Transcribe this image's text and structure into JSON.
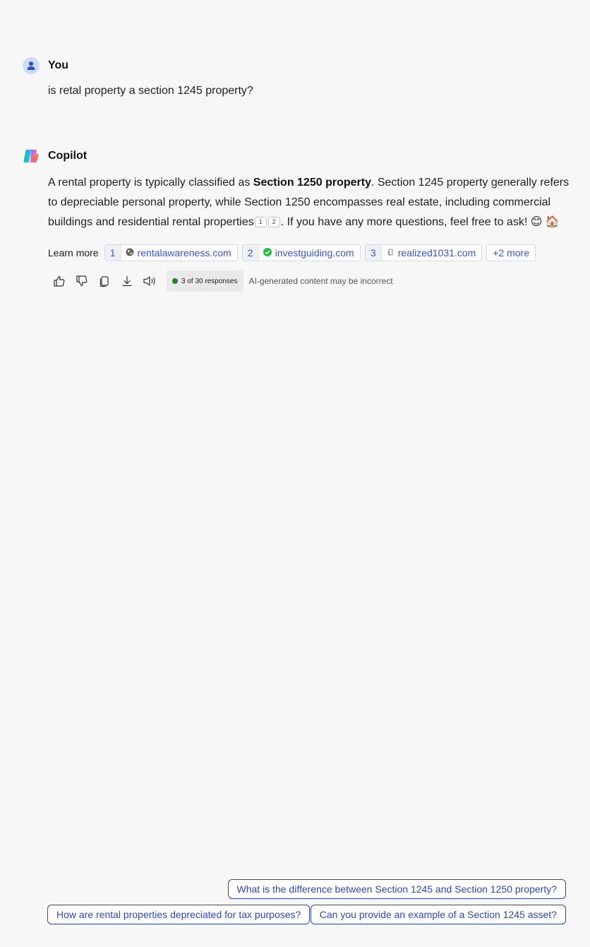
{
  "user": {
    "name": "You",
    "message": "is retal property a section 1245 property?"
  },
  "copilot": {
    "name": "Copilot",
    "answer": {
      "part1": "A rental property is typically classified as ",
      "bold": "Section 1250 property",
      "part2": ". Section 1245 property generally refers to depreciable personal property, while Section 1250 encompasses real estate, including commercial buildings and residential rental properties",
      "cite1": "1",
      "cite2": "2",
      "part3": ". If you have any more questions, feel free to ask! 😊 🏠"
    },
    "learn_more": {
      "label": "Learn more",
      "sources": [
        {
          "num": "1",
          "site": "rentalawareness.com",
          "icon": "globe-icon"
        },
        {
          "num": "2",
          "site": "investguiding.com",
          "icon": "check-circle-icon"
        },
        {
          "num": "3",
          "site": "realized1031.com",
          "icon": "document-icon"
        }
      ],
      "more": "+2 more"
    },
    "actions": {
      "icons": [
        "thumbs-up-icon",
        "thumbs-down-icon",
        "copy-icon",
        "download-icon",
        "speaker-icon"
      ],
      "responses": "3 of 30 responses",
      "disclaimer": "AI-generated content may be incorrect"
    }
  },
  "suggestions": [
    "What is the difference between Section 1245 and Section 1250 property?",
    "How are rental properties depreciated for tax purposes?",
    "Can you provide an example of a Section 1245 asset?"
  ],
  "colors": {
    "background": "#f7f7f7",
    "link": "#3a55c7",
    "suggestion_border": "#2e46b8",
    "status_dot": "#2e7d32"
  }
}
